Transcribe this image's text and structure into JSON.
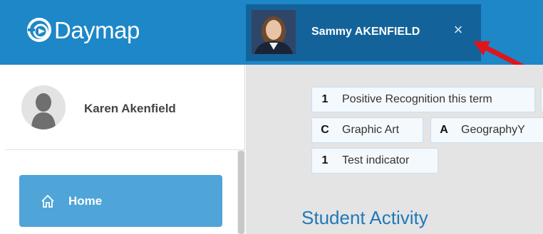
{
  "header": {
    "brand": "Daymap",
    "student_tab": {
      "name": "Sammy AKENFIELD",
      "close_symbol": "×"
    }
  },
  "sidebar": {
    "user_name": "Karen Akenfield",
    "nav_items": [
      {
        "label": "Home",
        "icon": "home-icon"
      }
    ]
  },
  "main": {
    "chips": [
      {
        "code": "1",
        "label": "Positive Recognition this term"
      },
      {
        "code": "C",
        "label": "Graphic Art"
      },
      {
        "code": "A",
        "label": "GeographyY"
      },
      {
        "code": "1",
        "label": "Test indicator"
      }
    ],
    "section_title": "Student Activity"
  },
  "colors": {
    "header_blue": "#1d87c7",
    "tab_blue": "#13639a",
    "nav_active": "#4fa4d8",
    "section_title": "#1f79b8",
    "annotation_red": "#e0141b"
  }
}
